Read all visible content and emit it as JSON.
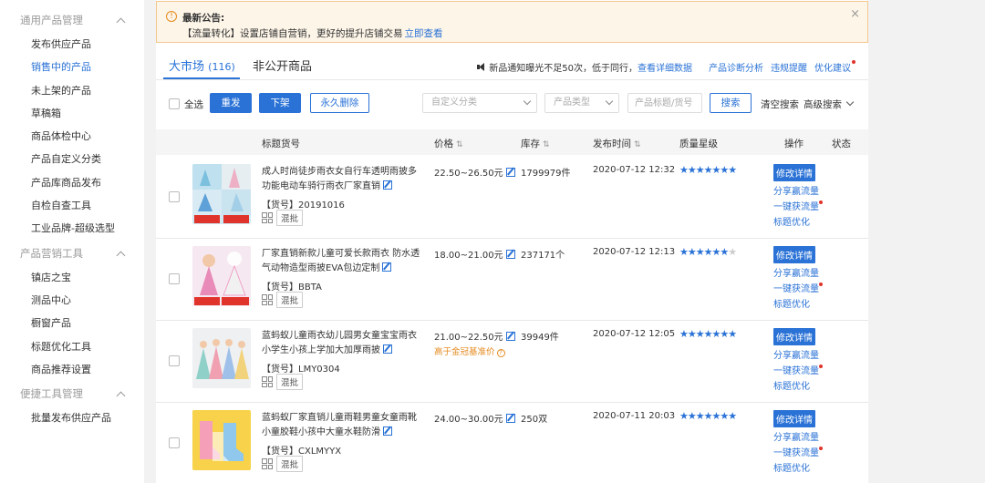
{
  "sidebar": {
    "groups": [
      {
        "title": "通用产品管理",
        "items": [
          "发布供应产品",
          "销售中的产品",
          "未上架的产品",
          "草稿箱",
          "商品体检中心",
          "产品自定义分类",
          "产品库商品发布",
          "自检自查工具",
          "工业品牌-超级选型"
        ]
      },
      {
        "title": "产品营销工具",
        "items": [
          "镇店之宝",
          "测品中心",
          "橱窗产品",
          "标题优化工具",
          "商品推荐设置"
        ]
      },
      {
        "title": "便捷工具管理",
        "items": [
          "批量发布供应产品"
        ]
      }
    ],
    "active_item": "销售中的产品"
  },
  "notice": {
    "icon": "!",
    "title": "最新公告:",
    "text": "【流量转化】设置店铺自营销，更好的提升店铺交易",
    "link": "立即查看",
    "close": "×"
  },
  "tabs": {
    "market_label": "大市场",
    "market_count": "(116)",
    "private_label": "非公开商品",
    "notice_text": "新品通知曝光不足50次，低于同行，",
    "notice_link": "查看详细数据",
    "link_diagnosis": "产品诊断分析",
    "link_violation": "违规提醒",
    "link_optimize": "优化建议"
  },
  "toolbar": {
    "select_all": "全选",
    "resend": "重发",
    "offline": "下架",
    "delete": "永久删除",
    "category_placeholder": "自定义分类",
    "type_placeholder": "产品类型",
    "search_placeholder": "产品标题/货号",
    "search": "搜索",
    "clear_search": "清空搜索",
    "advanced_search": "高级搜索"
  },
  "table": {
    "headers": {
      "title": "标题货号",
      "price": "价格",
      "stock": "库存",
      "date": "发布时间",
      "quality": "质量星级",
      "ops": "操作",
      "status": "状态"
    },
    "batch_label": "混批",
    "ops": {
      "edit": "修改详情",
      "share": "分享赢流量",
      "traffic": "一键获流量",
      "title_opt": "标题优化"
    },
    "rows": [
      {
        "title": "成人时尚徒步雨衣女自行车透明雨披多功能电动车骑行雨衣厂家直销",
        "sku": "【货号】20191016",
        "price": "22.50~26.50元",
        "price_note": "",
        "stock": "1799979件",
        "date": "2020-07-12 12:32",
        "stars": 7,
        "stars_total": 7
      },
      {
        "title": "厂家直销新款儿童可爱长款雨衣 防水透气动物造型雨披EVA包边定制",
        "sku": "【货号】BBTA",
        "price": "18.00~21.00元",
        "price_note": "",
        "stock": "237171个",
        "date": "2020-07-12 12:13",
        "stars": 6,
        "stars_total": 7
      },
      {
        "title": "蓝蚂蚁儿童雨衣幼儿园男女童宝宝雨衣小学生小孩上学加大加厚雨披",
        "sku": "【货号】LMY0304",
        "price": "21.00~22.50元",
        "price_note": "高于金冠基准价",
        "stock": "39949件",
        "date": "2020-07-12 12:05",
        "stars": 7,
        "stars_total": 7
      },
      {
        "title": "蓝蚂蚁厂家直销儿童雨鞋男童女童雨靴小童胶鞋小孩中大童水鞋防滑",
        "sku": "【货号】CXLMYYX",
        "price": "24.00~30.00元",
        "price_note": "",
        "stock": "250双",
        "date": "2020-07-11 20:03",
        "stars": 7,
        "stars_total": 7
      }
    ]
  },
  "colors": {
    "accent": "#2a72d6",
    "warning": "#e58a1f",
    "red_dot": "#e0332b"
  }
}
